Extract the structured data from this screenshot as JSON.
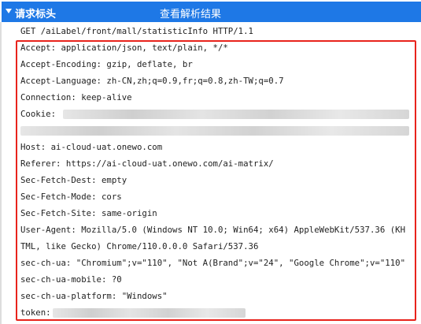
{
  "header": {
    "title": "请求标头",
    "view_parsed": "查看解析结果"
  },
  "request_line": "GET /aiLabel/front/mall/statisticInfo HTTP/1.1",
  "headers": [
    "Accept: application/json, text/plain, */*",
    "Accept-Encoding: gzip, deflate, br",
    "Accept-Language: zh-CN,zh;q=0.9,fr;q=0.8,zh-TW;q=0.7",
    "Connection: keep-alive",
    "Cookie:",
    "",
    "Host: ai-cloud-uat.onewo.com",
    "Referer: https://ai-cloud-uat.onewo.com/ai-matrix/",
    "Sec-Fetch-Dest: empty",
    "Sec-Fetch-Mode: cors",
    "Sec-Fetch-Site: same-origin",
    "User-Agent: Mozilla/5.0 (Windows NT 10.0; Win64; x64) AppleWebKit/537.36 (KH",
    "TML, like Gecko) Chrome/110.0.0.0 Safari/537.36",
    "sec-ch-ua: \"Chromium\";v=\"110\", \"Not A(Brand\";v=\"24\", \"Google Chrome\";v=\"110\"",
    "sec-ch-ua-mobile: ?0",
    "sec-ch-ua-platform: \"Windows\"",
    "token:"
  ],
  "colors": {
    "header_bg": "#1e78e6",
    "highlight_border": "#e8231c"
  }
}
